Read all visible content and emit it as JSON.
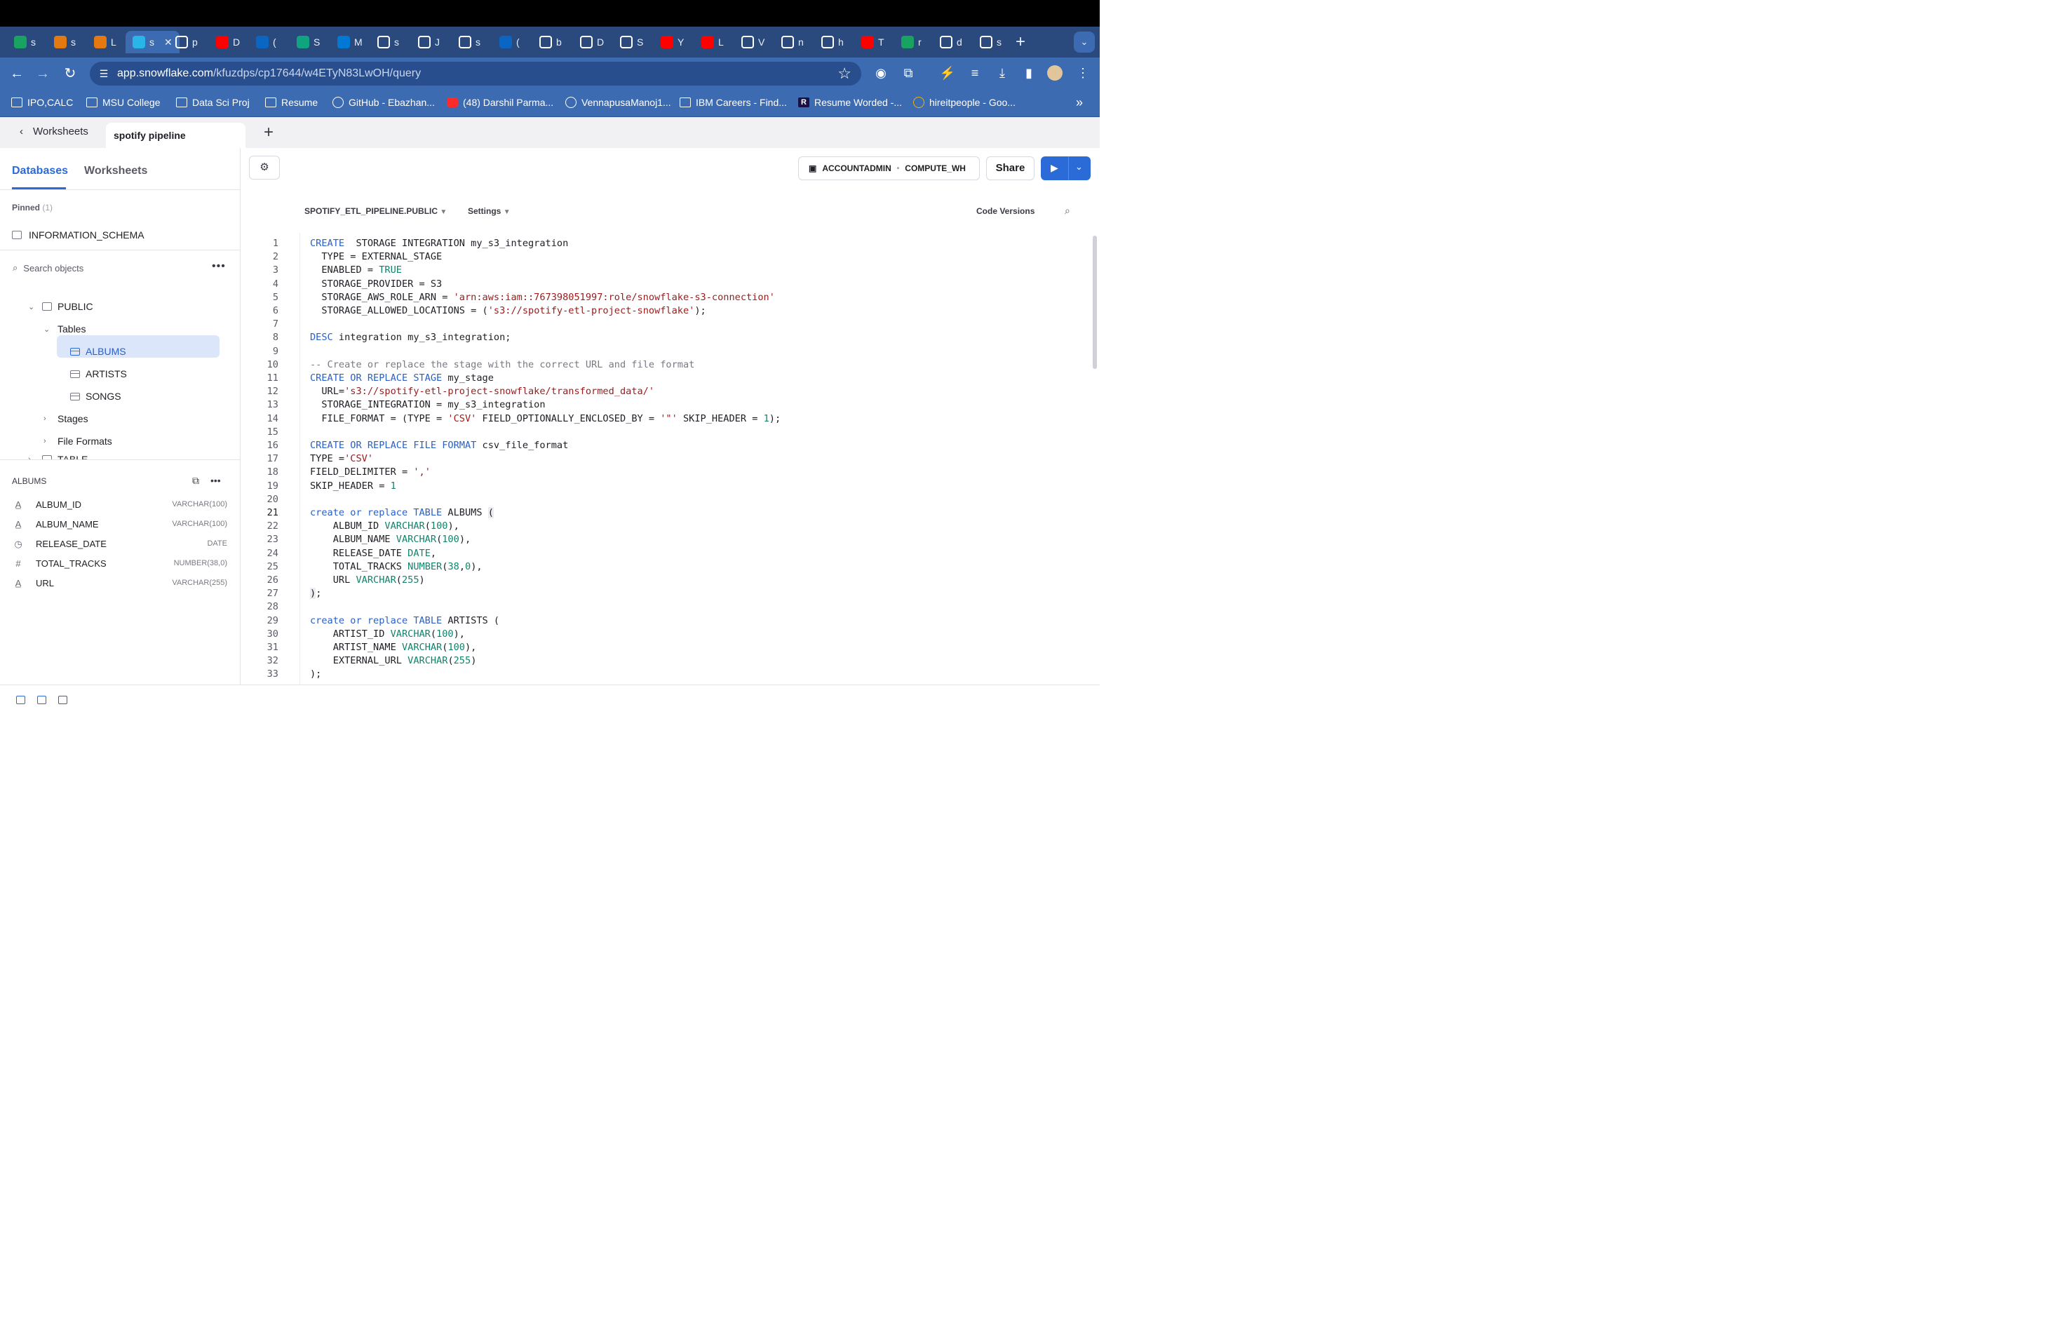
{
  "browser": {
    "tabs": [
      {
        "label": "s",
        "icon": "sheets-icon",
        "color": "#1aa260"
      },
      {
        "label": "s",
        "icon": "aws-icon",
        "color": "#e47911"
      },
      {
        "label": "L",
        "icon": "aws-icon",
        "color": "#e47911"
      },
      {
        "label": "s",
        "icon": "snowflake-icon",
        "color": "#29b5e8",
        "active": true
      },
      {
        "label": "p",
        "icon": "github-icon",
        "color": "#ffffff"
      },
      {
        "label": "D",
        "icon": "youtube-icon",
        "color": "#ff0000"
      },
      {
        "label": "(",
        "icon": "linkedin-icon",
        "color": "#0a66c2"
      },
      {
        "label": "S",
        "icon": "chatgpt-icon",
        "color": "#10a37f"
      },
      {
        "label": "M",
        "icon": "outlook-icon",
        "color": "#0078d4"
      },
      {
        "label": "s",
        "icon": "chrome-icon",
        "color": "#ffffff"
      },
      {
        "label": "J",
        "icon": "github-icon",
        "color": "#ffffff"
      },
      {
        "label": "s",
        "icon": "github-icon",
        "color": "#ffffff"
      },
      {
        "label": "(",
        "icon": "linkedin-icon",
        "color": "#0a66c2"
      },
      {
        "label": "b",
        "icon": "github-icon",
        "color": "#ffffff"
      },
      {
        "label": "D",
        "icon": "gear-icon",
        "color": "#ffffff"
      },
      {
        "label": "S",
        "icon": "gear-icon",
        "color": "#ffffff"
      },
      {
        "label": "Y",
        "icon": "youtube-icon",
        "color": "#ff0000"
      },
      {
        "label": "L",
        "icon": "youtube-icon",
        "color": "#ff0000"
      },
      {
        "label": "V",
        "icon": "github-icon",
        "color": "#ffffff"
      },
      {
        "label": "n",
        "icon": "google-icon",
        "color": "#ffffff"
      },
      {
        "label": "h",
        "icon": "google-icon",
        "color": "#ffffff"
      },
      {
        "label": "T",
        "icon": "youtube-icon",
        "color": "#ff0000"
      },
      {
        "label": "r",
        "icon": "sheets-icon",
        "color": "#1aa260"
      },
      {
        "label": "d",
        "icon": "google-icon",
        "color": "#ffffff"
      },
      {
        "label": "s",
        "icon": "google-icon",
        "color": "#ffffff"
      }
    ],
    "url_host": "app.snowflake.com",
    "url_path": "/kfuzdps/cp17644/w4ETyN83LwOH/query",
    "bookmarks": [
      {
        "label": "IPO,CALC",
        "icon": "folder"
      },
      {
        "label": "MSU College",
        "icon": "folder"
      },
      {
        "label": "Data Sci Proj",
        "icon": "folder"
      },
      {
        "label": "Resume",
        "icon": "folder"
      },
      {
        "label": "GitHub - Ebazhan...",
        "icon": "github"
      },
      {
        "label": "(48) Darshil Parma...",
        "icon": "youtube"
      },
      {
        "label": "VennapusaManoj1...",
        "icon": "github"
      },
      {
        "label": "IBM Careers - Find...",
        "icon": "ibm"
      },
      {
        "label": "Resume Worded -...",
        "icon": "r"
      },
      {
        "label": "hireitpeople - Goo...",
        "icon": "google"
      }
    ]
  },
  "app": {
    "back_label": "Worksheets",
    "worksheet_tab": "spotify pipeline",
    "left_tabs": {
      "databases": "Databases",
      "worksheets": "Worksheets"
    },
    "pinned_label": "Pinned",
    "pinned_count": "(1)",
    "pinned_item": "INFORMATION_SCHEMA",
    "search_placeholder": "Search objects",
    "tree": {
      "schema": "PUBLIC",
      "tables_label": "Tables",
      "tables": [
        "ALBUMS",
        "ARTISTS",
        "SONGS"
      ],
      "stages_label": "Stages",
      "file_formats_label": "File Formats",
      "next_item": "TABLE"
    },
    "details_title": "ALBUMS",
    "columns": [
      {
        "name": "ALBUM_ID",
        "type": "VARCHAR(100)",
        "icon": "text-icon"
      },
      {
        "name": "ALBUM_NAME",
        "type": "VARCHAR(100)",
        "icon": "text-icon"
      },
      {
        "name": "RELEASE_DATE",
        "type": "DATE",
        "icon": "clock-icon"
      },
      {
        "name": "TOTAL_TRACKS",
        "type": "NUMBER(38,0)",
        "icon": "hash-icon"
      },
      {
        "name": "URL",
        "type": "VARCHAR(255)",
        "icon": "text-icon"
      }
    ],
    "role": "ACCOUNTADMIN",
    "warehouse": "COMPUTE_WH",
    "share_label": "Share",
    "context_db": "SPOTIFY_ETL_PIPELINE.PUBLIC",
    "settings_label": "Settings",
    "code_versions_label": "Code Versions",
    "current_line": 21
  },
  "code_lines": [
    [
      [
        "kw",
        "CREATE"
      ],
      [
        "",
        "  STORAGE INTEGRATION my_s3_integration"
      ]
    ],
    [
      [
        "",
        "  TYPE = EXTERNAL_STAGE"
      ]
    ],
    [
      [
        "",
        "  ENABLED = "
      ],
      [
        "typ",
        "TRUE"
      ]
    ],
    [
      [
        "",
        "  STORAGE_PROVIDER = S3"
      ]
    ],
    [
      [
        "",
        "  STORAGE_AWS_ROLE_ARN = "
      ],
      [
        "str",
        "'arn:aws:iam::767398051997:role/snowflake-s3-connection'"
      ]
    ],
    [
      [
        "",
        "  STORAGE_ALLOWED_LOCATIONS = ("
      ],
      [
        "str",
        "'s3://spotify-etl-project-snowflake'"
      ],
      [
        "",
        ");"
      ]
    ],
    [
      [
        "",
        ""
      ]
    ],
    [
      [
        "kw",
        "DESC"
      ],
      [
        "",
        " integration my_s3_integration;"
      ]
    ],
    [
      [
        "",
        ""
      ]
    ],
    [
      [
        "cm",
        "-- Create or replace the stage with the correct URL and file format"
      ]
    ],
    [
      [
        "kw",
        "CREATE OR REPLACE STAGE"
      ],
      [
        "",
        " my_stage"
      ]
    ],
    [
      [
        "",
        "  URL="
      ],
      [
        "str",
        "'s3://spotify-etl-project-snowflake/transformed_data/'"
      ]
    ],
    [
      [
        "",
        "  STORAGE_INTEGRATION = my_s3_integration"
      ]
    ],
    [
      [
        "",
        "  FILE_FORMAT = (TYPE = "
      ],
      [
        "str",
        "'CSV'"
      ],
      [
        "",
        " FIELD_OPTIONALLY_ENCLOSED_BY = "
      ],
      [
        "str",
        "'\"'"
      ],
      [
        "",
        " SKIP_HEADER = "
      ],
      [
        "num",
        "1"
      ],
      [
        "",
        ");"
      ]
    ],
    [
      [
        "",
        ""
      ]
    ],
    [
      [
        "kw",
        "CREATE OR REPLACE FILE FORMAT"
      ],
      [
        "",
        " csv_file_format"
      ]
    ],
    [
      [
        "",
        "TYPE ="
      ],
      [
        "str",
        "'CSV'"
      ]
    ],
    [
      [
        "",
        "FIELD_DELIMITER = "
      ],
      [
        "str",
        "','"
      ]
    ],
    [
      [
        "",
        "SKIP_HEADER = "
      ],
      [
        "num",
        "1"
      ]
    ],
    [
      [
        "",
        ""
      ]
    ],
    [
      [
        "kw",
        "create or replace TABLE"
      ],
      [
        "",
        " ALBUMS "
      ],
      [
        "brk",
        "("
      ]
    ],
    [
      [
        "",
        "    ALBUM_ID "
      ],
      [
        "typ",
        "VARCHAR"
      ],
      [
        "",
        "("
      ],
      [
        "num",
        "100"
      ],
      [
        "",
        "),"
      ]
    ],
    [
      [
        "",
        "    ALBUM_NAME "
      ],
      [
        "typ",
        "VARCHAR"
      ],
      [
        "",
        "("
      ],
      [
        "num",
        "100"
      ],
      [
        "",
        "),"
      ]
    ],
    [
      [
        "",
        "    RELEASE_DATE "
      ],
      [
        "typ",
        "DATE"
      ],
      [
        "",
        ","
      ]
    ],
    [
      [
        "",
        "    TOTAL_TRACKS "
      ],
      [
        "typ",
        "NUMBER"
      ],
      [
        "",
        "("
      ],
      [
        "num",
        "38"
      ],
      [
        "",
        ","
      ],
      [
        "num",
        "0"
      ],
      [
        "",
        "),"
      ]
    ],
    [
      [
        "",
        "    URL "
      ],
      [
        "typ",
        "VARCHAR"
      ],
      [
        "",
        "("
      ],
      [
        "num",
        "255"
      ],
      [
        "",
        ")"
      ]
    ],
    [
      [
        "brk",
        ")"
      ],
      [
        "",
        ";"
      ]
    ],
    [
      [
        "",
        ""
      ]
    ],
    [
      [
        "kw",
        "create or replace TABLE"
      ],
      [
        "",
        " ARTISTS ("
      ]
    ],
    [
      [
        "",
        "    ARTIST_ID "
      ],
      [
        "typ",
        "VARCHAR"
      ],
      [
        "",
        "("
      ],
      [
        "num",
        "100"
      ],
      [
        "",
        "),"
      ]
    ],
    [
      [
        "",
        "    ARTIST_NAME "
      ],
      [
        "typ",
        "VARCHAR"
      ],
      [
        "",
        "("
      ],
      [
        "num",
        "100"
      ],
      [
        "",
        "),"
      ]
    ],
    [
      [
        "",
        "    EXTERNAL_URL "
      ],
      [
        "typ",
        "VARCHAR"
      ],
      [
        "",
        "("
      ],
      [
        "num",
        "255"
      ],
      [
        "",
        ")"
      ]
    ],
    [
      [
        "",
        ");"
      ]
    ]
  ]
}
